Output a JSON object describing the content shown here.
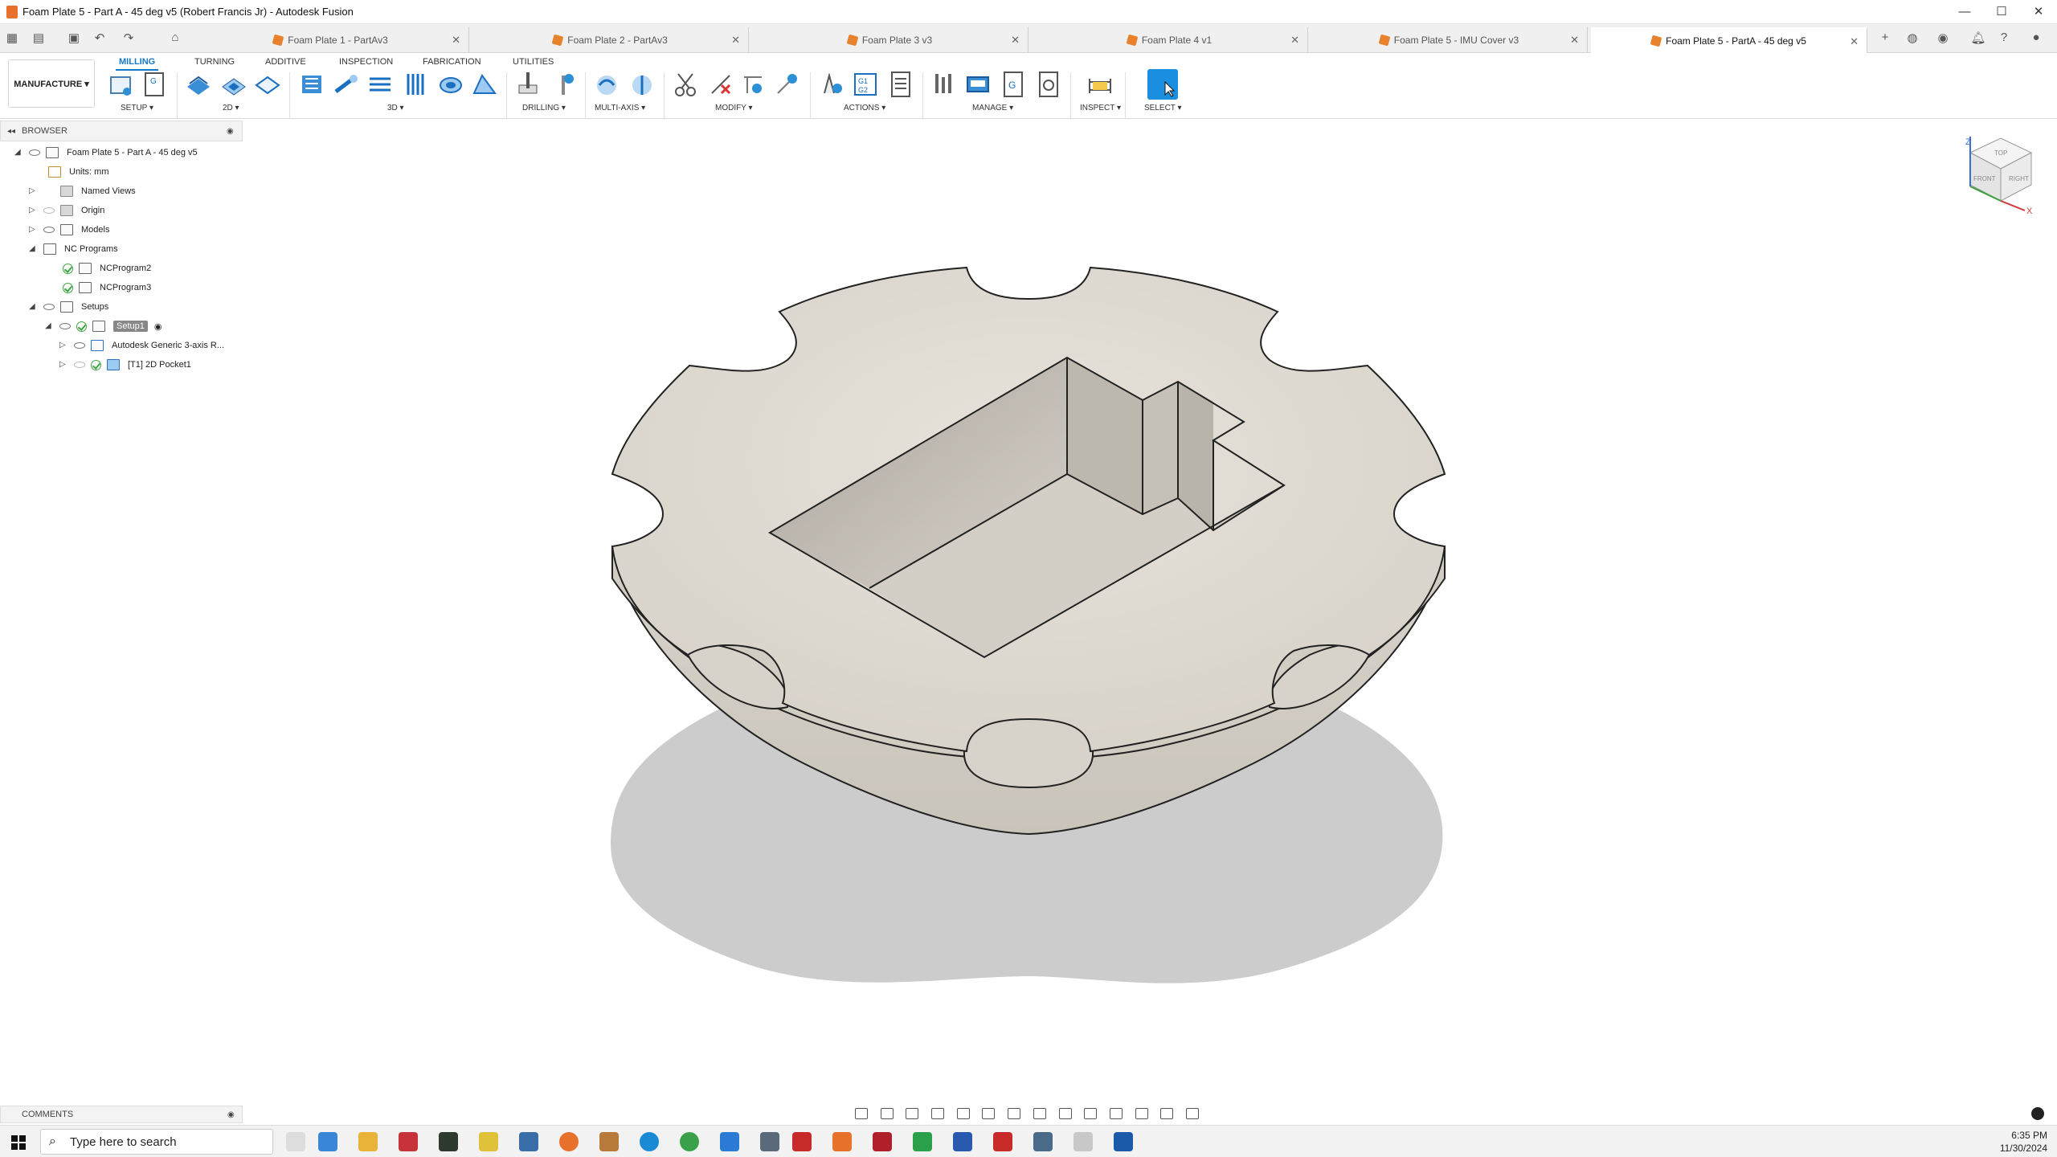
{
  "titlebar": {
    "title": "Foam Plate 5 - Part A - 45 deg v5 (Robert Francis Jr) - Autodesk Fusion"
  },
  "tabs": [
    {
      "label": "Foam Plate 1 - PartAv3"
    },
    {
      "label": "Foam Plate 2 - PartAv3"
    },
    {
      "label": "Foam Plate 3 v3"
    },
    {
      "label": "Foam Plate 4 v1"
    },
    {
      "label": "Foam Plate 5 - IMU Cover v3"
    },
    {
      "label": "Foam Plate 5 - PartA - 45 deg v5"
    }
  ],
  "toolbar": {
    "workspace": "MANUFACTURE ▾",
    "top_tabs": [
      "MILLING",
      "TURNING",
      "ADDITIVE",
      "INSPECTION",
      "FABRICATION",
      "UTILITIES"
    ],
    "groups": [
      "SETUP ▾",
      "2D ▾",
      "3D ▾",
      "DRILLING ▾",
      "MULTI-AXIS ▾",
      "MODIFY ▾",
      "ACTIONS ▾",
      "MANAGE ▾",
      "INSPECT ▾",
      "SELECT ▾"
    ]
  },
  "browser": {
    "header": "BROWSER",
    "items": [
      {
        "label": "Foam Plate 5 - Part A - 45 deg v5"
      },
      {
        "label": "Units: mm"
      },
      {
        "label": "Named Views"
      },
      {
        "label": "Origin"
      },
      {
        "label": "Models"
      },
      {
        "label": "NC Programs"
      },
      {
        "label": "NCProgram2"
      },
      {
        "label": "NCProgram3"
      },
      {
        "label": "Setups"
      },
      {
        "label": "Setup1"
      },
      {
        "label": "Autodesk Generic 3-axis R..."
      },
      {
        "label": "[T1] 2D Pocket1"
      }
    ]
  },
  "viewcube": {
    "faces": [
      "TOP",
      "FRONT",
      "RIGHT"
    ],
    "axes": [
      "Z",
      "X"
    ]
  },
  "comments": {
    "label": "COMMENTS"
  },
  "taskbar": {
    "search_placeholder": "Type here to search",
    "time": "6:35 PM",
    "date": "11/30/2024"
  },
  "colors": {
    "accent": "#1779c9",
    "foam": "#dedad2",
    "brand": "#e8712c"
  }
}
